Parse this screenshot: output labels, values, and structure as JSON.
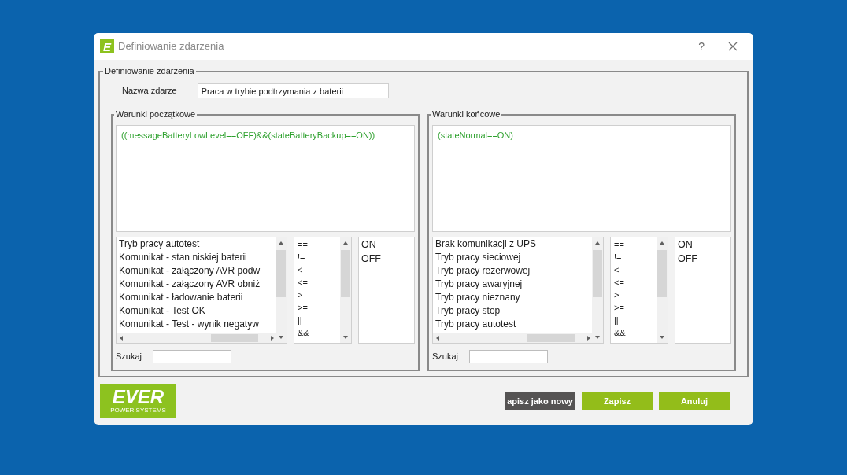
{
  "window": {
    "icon_letter": "E",
    "title": "Definiowanie zdarzenia",
    "help": "?"
  },
  "group_title": "Definiowanie zdarzenia",
  "event_name": {
    "label": "Nazwa zdarze",
    "value": "Praca w trybie podtrzymania z baterii"
  },
  "panels": [
    {
      "title": "Warunki początkowe",
      "expression": "((messageBatteryLowLevel==OFF)&&(stateBatteryBackup==ON))",
      "variables": [
        "Tryb pracy autotest",
        "Komunikat - stan niskiej baterii",
        "Komunikat - załączony AVR podw",
        "Komunikat - załączony AVR obniż",
        "Komunikat - ładowanie baterii",
        "Komunikat - Test OK",
        "Komunikat - Test - wynik negatyw"
      ],
      "operators": [
        "==",
        "!=",
        "<",
        "<=",
        ">",
        ">=",
        "||",
        "&&"
      ],
      "values": [
        "ON",
        "OFF"
      ],
      "search_label": "Szukaj"
    },
    {
      "title": "Warunki końcowe",
      "expression": "(stateNormal==ON)",
      "variables": [
        "Brak komunikacji z UPS",
        "Tryb pracy sieciowej",
        "Tryb pracy rezerwowej",
        "Tryb pracy awaryjnej",
        "Tryb pracy nieznany",
        "Tryb pracy stop",
        "Tryb pracy autotest"
      ],
      "operators": [
        "==",
        "!=",
        "<",
        "<=",
        ">",
        ">=",
        "||",
        "&&"
      ],
      "values": [
        "ON",
        "OFF"
      ],
      "search_label": "Szukaj"
    }
  ],
  "logo": {
    "name": "EVER",
    "tagline": "POWER SYSTEMS"
  },
  "buttons": [
    {
      "label": "apisz jako nowy",
      "kind": "dark"
    },
    {
      "label": "Zapisz",
      "kind": "green"
    },
    {
      "label": "Anuluj",
      "kind": "green"
    }
  ]
}
